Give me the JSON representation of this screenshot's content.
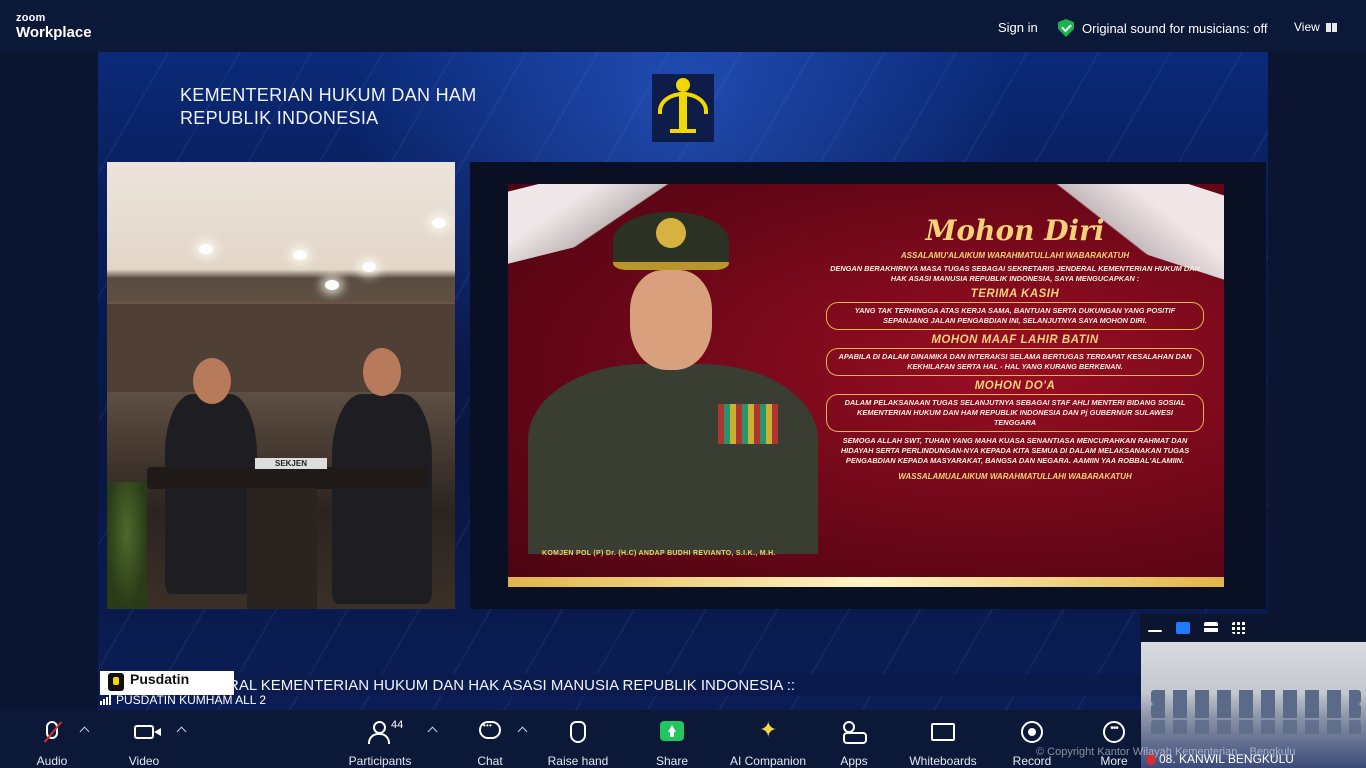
{
  "topbar": {
    "logo_small": "zoom",
    "logo_big": "Workplace",
    "signin": "Sign in",
    "original_sound": "Original sound for musicians: off",
    "view": "View"
  },
  "stage": {
    "ministry_line1": "KEMENTERIAN HUKUM DAN HAM",
    "ministry_line2": "REPUBLIK INDONESIA",
    "placard": "SEKJEN",
    "slide": {
      "title": "Mohon Diri",
      "greeting": "ASSALAMU'ALAIKUM WARAHMATULLAHI WABARAKATUH",
      "intro": "DENGAN BERAKHIRNYA MASA TUGAS SEBAGAI SEKRETARIS JENDERAL KEMENTERIAN HUKUM DAN HAK ASASI MANUSIA REPUBLIK INDONESIA, SAYA MENGUCAPKAN :",
      "h1": "TERIMA KASIH",
      "p1": "YANG TAK TERHINGGA ATAS KERJA SAMA, BANTUAN SERTA DUKUNGAN YANG POSITIF SEPANJANG JALAN PENGABDIAN INI, SELANJUTNYA SAYA MOHON DIRI.",
      "h2": "MOHON MAAF LAHIR BATIN",
      "p2": "APABILA DI DALAM DINAMIKA DAN INTERAKSI SELAMA BERTUGAS TERDAPAT KESALAHAN DAN KEKHILAFAN SERTA HAL - HAL YANG KURANG BERKENAN.",
      "h3": "MOHON DO'A",
      "p3": "DALAM PELAKSANAAN TUGAS SELANJUTNYA SEBAGAI STAF AHLI MENTERI BIDANG SOSIAL KEMENTERIAN HUKUM DAN HAM REPUBLIK INDONESIA DAN Pj GUBERNUR SULAWESI TENGGARA",
      "p4": "SEMOGA ALLAH SWT, TUHAN YANG MAHA KUASA SENANTIASA MENCURAHKAN RAHMAT DAN HIDAYAH SERTA PERLINDUNGAN-NYA KEPADA KITA SEMUA DI DALAM MELAKSANAKAN TUGAS PENGABDIAN KEPADA MASYARAKAT, BANGSA DAN NEGARA. AAMIIN YAA ROBBAL'ALAMIIN.",
      "closing": "WASSALAMUALAIKUM WARAHMATULLAHI WABARAKATUH",
      "signature": "KOMJEN POL (P) Dr. (H.C) ANDAP BUDHI REVIANTO, S.I.K., M.H."
    },
    "ticker_brand": "Pusdatin",
    "ticker_text": "RAL KEMENTERIAN HUKUM DAN HAK ASASI MANUSIA REPUBLIK INDONESIA ::",
    "speaker_name": "PUSDATIN KUMHAM ALL 2"
  },
  "thumbnail": {
    "label": "08. KANWIL BENGKULU"
  },
  "toolbar": {
    "audio": "Audio",
    "video": "Video",
    "participants": "Participants",
    "participants_count": "44",
    "chat": "Chat",
    "raise_hand": "Raise hand",
    "share": "Share",
    "ai_companion": "AI Companion",
    "apps": "Apps",
    "whiteboards": "Whiteboards",
    "record": "Record",
    "more": "More",
    "copyright": "© Copyright Kantor Wilayah Kementerian... Bengkulu"
  },
  "colors": {
    "topbar_bg": "#0c1838",
    "share_green": "#22c55e",
    "shield_green": "#1bb34c",
    "active_view_blue": "#1f7bff",
    "muted_red": "#e02a2a",
    "slide_gold": "#f4d27a"
  }
}
